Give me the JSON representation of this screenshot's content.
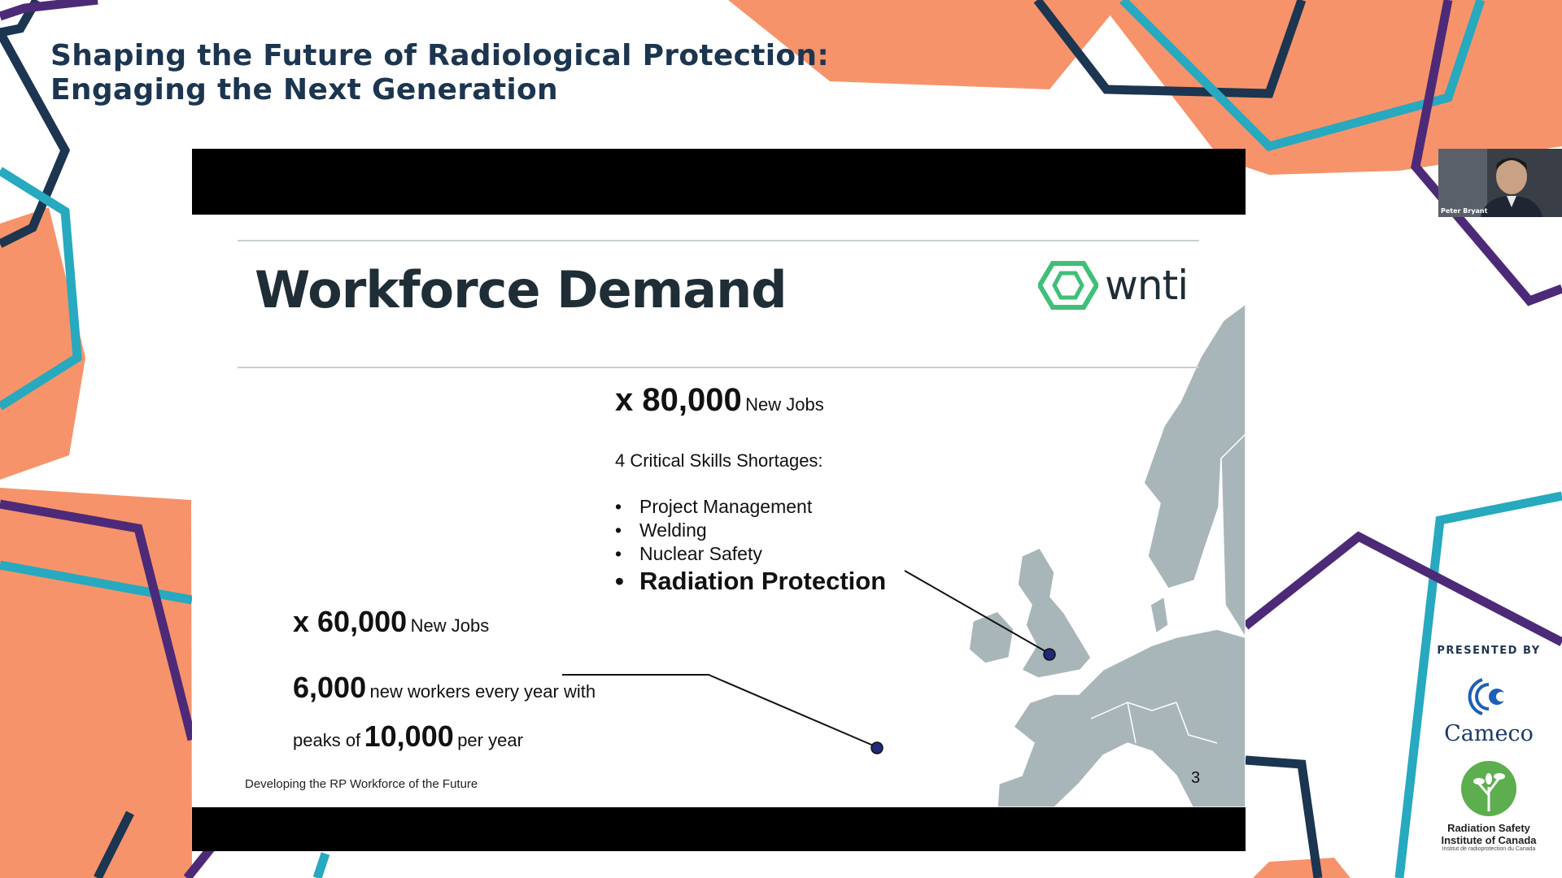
{
  "event": {
    "title_line1": "Shaping the Future of Radiological Protection:",
    "title_line2": "Engaging the Next Generation"
  },
  "slide": {
    "heading": "Workforce Demand",
    "logo_text": "wnti",
    "stat_80k": {
      "multiplier": "x 80,000",
      "label": "New Jobs"
    },
    "shortages_title": "4 Critical Skills Shortages:",
    "skills": [
      {
        "bullet": "•",
        "label": "Project Management"
      },
      {
        "bullet": "•",
        "label": "Welding"
      },
      {
        "bullet": "•",
        "label": "Nuclear Safety"
      },
      {
        "bullet": "•",
        "label": "Radiation Protection"
      }
    ],
    "stat_60k": {
      "multiplier": "x 60,000",
      "label": "New Jobs"
    },
    "workers": {
      "num1": "6,000",
      "text1": "new workers every year with",
      "text2": "peaks of",
      "num2": "10,000",
      "text3": "per year"
    },
    "footer": "Developing the RP Workforce of the Future",
    "page_number": "3"
  },
  "speaker": {
    "name": "Peter Bryant"
  },
  "sponsors": {
    "presented_by": "PRESENTED BY",
    "cameco": "Cameco",
    "rsic_line1": "Radiation Safety",
    "rsic_line2": "Institute of Canada",
    "rsic_sub": "Institut de radioprotection du Canada"
  },
  "colors": {
    "orange": "#f7936a",
    "navy": "#1c3550",
    "teal": "#27a9bf",
    "purple": "#4d2a78",
    "wnti_green": "#3fbf77",
    "map_gray": "#a9b6b9"
  }
}
